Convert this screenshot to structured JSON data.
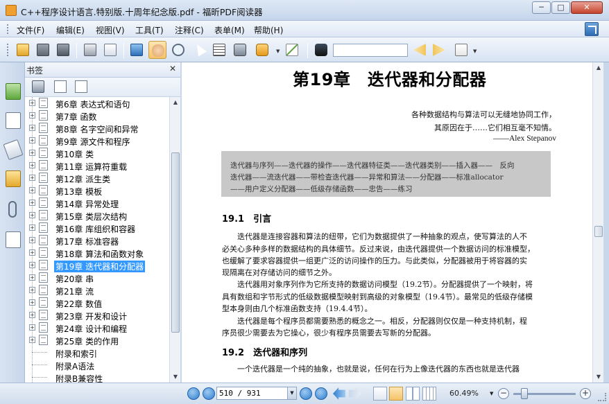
{
  "window": {
    "title": "C++程序设计语言.特别版.十周年纪念版.pdf - 福昕PDF阅读器",
    "minimize_glyph": "─",
    "maximize_glyph": "□",
    "close_glyph": "✕"
  },
  "menu": {
    "items": [
      {
        "label": "文件(F)"
      },
      {
        "label": "编辑(E)"
      },
      {
        "label": "视图(V)"
      },
      {
        "label": "工具(T)"
      },
      {
        "label": "注释(C)"
      },
      {
        "label": "表单(M)"
      },
      {
        "label": "帮助(H)"
      }
    ]
  },
  "toolbar": {
    "search_value": "",
    "icons": [
      "open-icon",
      "save-icon",
      "save-as-icon",
      "print-icon",
      "email-icon",
      "fullscreen-icon",
      "hand-tool-icon",
      "zoom-tool-icon",
      "select-tool-icon",
      "text-select-icon",
      "snapshot-icon",
      "rms-icon",
      "sign-icon",
      "find-icon",
      "find-prev-icon",
      "find-next-icon",
      "typewriter-icon"
    ],
    "active_tool": "hand-tool-icon"
  },
  "bookmarks": {
    "header": "书签",
    "close_glyph": "✕",
    "items": [
      {
        "label": "第6章 表达式和语句",
        "expandable": true
      },
      {
        "label": "第7章 函数",
        "expandable": true
      },
      {
        "label": "第8章 名字空间和异常",
        "expandable": true
      },
      {
        "label": "第9章 源文件和程序",
        "expandable": true
      },
      {
        "label": "第10章 类",
        "expandable": true
      },
      {
        "label": "第11章 运算符重载",
        "expandable": true
      },
      {
        "label": "第12章 派生类",
        "expandable": true
      },
      {
        "label": "第13章 模板",
        "expandable": true
      },
      {
        "label": "第14章 异常处理",
        "expandable": true
      },
      {
        "label": "第15章 类层次结构",
        "expandable": true
      },
      {
        "label": "第16章 库组织和容器",
        "expandable": true
      },
      {
        "label": "第17章 标准容器",
        "expandable": true
      },
      {
        "label": "第18章 算法和函数对象",
        "expandable": true
      },
      {
        "label": "第19章 迭代器和分配器",
        "expandable": true,
        "selected": true
      },
      {
        "label": "第20章 串",
        "expandable": true
      },
      {
        "label": "第21章 流",
        "expandable": true
      },
      {
        "label": "第22章 数值",
        "expandable": true
      },
      {
        "label": "第23章 开发和设计",
        "expandable": true
      },
      {
        "label": "第24章 设计和编程",
        "expandable": true
      },
      {
        "label": "第25章 类的作用",
        "expandable": true
      },
      {
        "label": "附录和索引",
        "expandable": false
      },
      {
        "label": "附录A语法",
        "expandable": false
      },
      {
        "label": "附录B兼容性",
        "expandable": false
      }
    ]
  },
  "document": {
    "chapter_title": "第19章　迭代器和分配器",
    "epigraph": [
      "各种数据结构与算法可以无缝地协同工作，",
      "其原因在于……它们相互毫不知情。",
      "——Alex Stepanov"
    ],
    "summary": [
      "迭代器与序列——迭代器的操作——迭代器特征类——迭代器类别——插入器——　反向",
      "迭代器——流迭代器——带检查迭代器——异常和算法——分配器——标准allocator",
      "——用户定义分配器——低级存储函数——忠告——练习"
    ],
    "sections": [
      {
        "heading": "19.1　引言",
        "lines": [
          "　　迭代器是连接容器和算法的纽带，它们为数据提供了一种抽象的观点，使写算法的人不",
          "必关心多种多样的数据结构的具体细节。反过来说，由迭代器提供一个数据访问的标准模型，",
          "也缓解了要求容器提供一组更广泛的访问操作的压力。与此类似，分配器被用于将容器的实",
          "现隔离在对存储访问的细节之外。",
          "　　迭代器用对象序列作为它所支持的数据访问模型（19.2节）。分配器提供了一个映射，将",
          "具有数组和字节形式的低级数据模型映射到高级的对象模型（19.4节）。最常见的低级存储模",
          "型本身则由几个标准函数支持（19.4.4节）。",
          "　　迭代器是每个程序员都需要熟悉的概念之一。相反，分配器则仅仅是一种支持机制，程",
          "序员很少需要去为它操心，很少有程序员需要去写新的分配器。"
        ]
      },
      {
        "heading": "19.2　迭代器和序列",
        "lines": [
          "　　一个迭代器是一个纯的抽象，也就是说，任何在行为上像迭代器的东西也就是迭代器"
        ]
      }
    ]
  },
  "statusbar": {
    "page_value": "510 / 931",
    "zoom_value": "60.49%",
    "zoom_fraction": 0.18
  },
  "colors": {
    "selection": "#3399ff",
    "frame": "#c9d7ea"
  }
}
